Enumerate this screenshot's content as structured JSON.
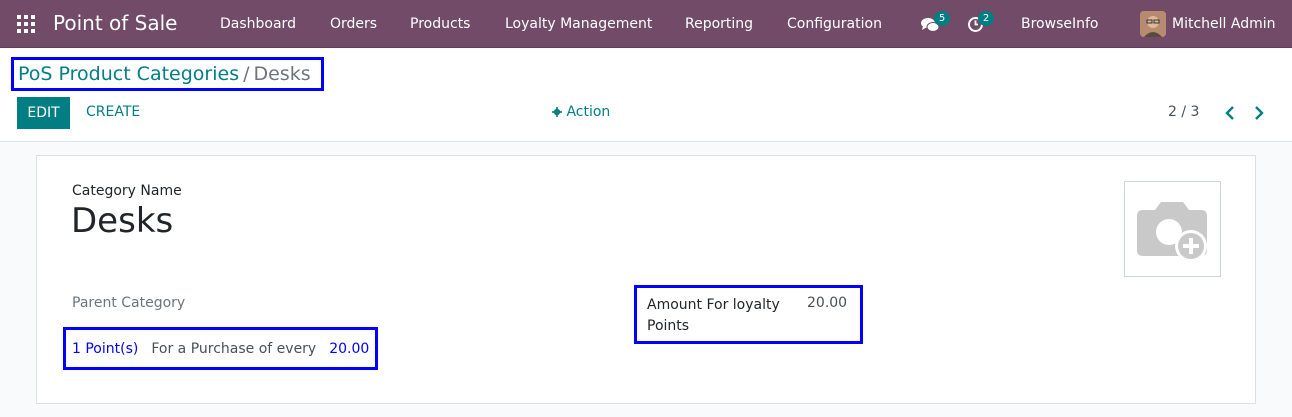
{
  "navbar": {
    "app_title": "Point of Sale",
    "menu": [
      "Dashboard",
      "Orders",
      "Products",
      "Loyalty Management",
      "Reporting",
      "Configuration"
    ],
    "messages_count": "5",
    "activities_count": "2",
    "company": "BrowseInfo",
    "user": "Mitchell Admin"
  },
  "breadcrumb": {
    "parent": "PoS Product Categories",
    "separator": "/",
    "current": "Desks"
  },
  "toolbar": {
    "edit_label": "EDIT",
    "create_label": "CREATE",
    "action_label": "Action",
    "pager": "2 / 3"
  },
  "form": {
    "category_name_label": "Category Name",
    "category_name_value": "Desks",
    "parent_category_label": "Parent Category",
    "loyalty_points": "1 Point(s)",
    "loyalty_for_text": "For a Purchase of every",
    "loyalty_purchase_amount": "20.00",
    "amount_loyalty_label": "Amount For loyalty Points",
    "amount_loyalty_value": "20.00"
  },
  "colors": {
    "navbar": "#714b67",
    "accent": "#017e84",
    "highlight": "#0000ff"
  }
}
